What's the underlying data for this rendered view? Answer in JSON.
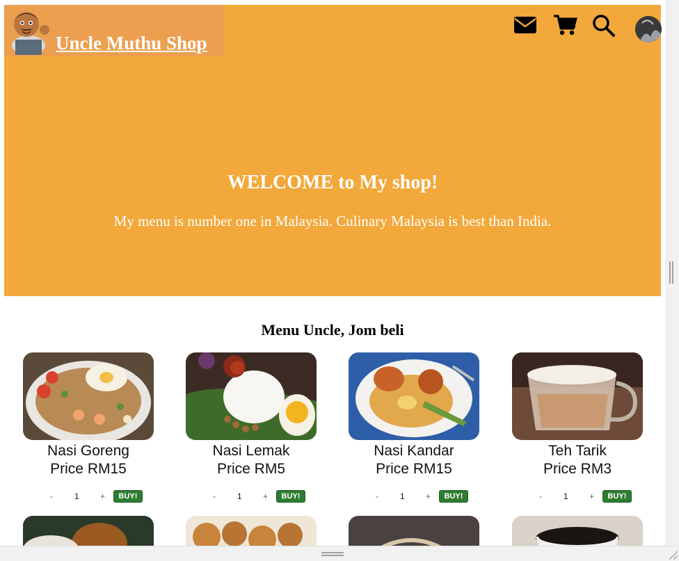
{
  "brand": {
    "name": "Uncle Muthu Shop",
    "logo_icon": "mascot-icon"
  },
  "nav": {
    "icons": [
      "mail-icon",
      "cart-icon",
      "search-icon",
      "user-avatar"
    ]
  },
  "hero": {
    "title": "WELCOME to My shop!",
    "subtitle": "My menu is number one in Malaysia. Culinary Malaysia is best than India.",
    "background": "#f2a83a"
  },
  "menu": {
    "heading": "Menu Uncle, Jom beli",
    "items": [
      {
        "name": "Nasi Goreng",
        "price": "Price RM15",
        "qty": "1",
        "minus": "-",
        "plus": "+",
        "buy": "BUY!"
      },
      {
        "name": "Nasi Lemak",
        "price": "Price RM5",
        "qty": "1",
        "minus": "-",
        "plus": "+",
        "buy": "BUY!"
      },
      {
        "name": "Nasi Kandar",
        "price": "Price RM15",
        "qty": "1",
        "minus": "-",
        "plus": "+",
        "buy": "BUY!"
      },
      {
        "name": "Teh Tarik",
        "price": "Price RM3",
        "qty": "1",
        "minus": "-",
        "plus": "+",
        "buy": "BUY!"
      }
    ]
  },
  "colors": {
    "accent": "#f2a83a",
    "brand_bg": "#ec9f4f",
    "buy": "#2e7d32"
  }
}
